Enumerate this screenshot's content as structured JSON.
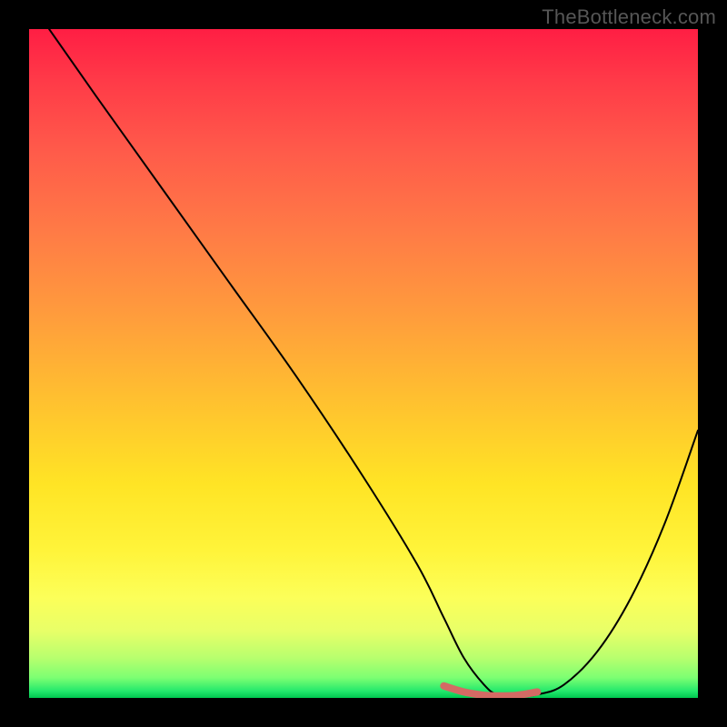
{
  "watermark": "TheBottleneck.com",
  "chart_data": {
    "type": "line",
    "title": "",
    "xlabel": "",
    "ylabel": "",
    "xlim": [
      0,
      100
    ],
    "ylim": [
      0,
      100
    ],
    "grid": false,
    "legend": false,
    "series": [
      {
        "name": "curve",
        "color": "#000000",
        "x": [
          3,
          10,
          20,
          30,
          40,
          50,
          58,
          62,
          65,
          68,
          70,
          73,
          76,
          80,
          85,
          90,
          95,
          100
        ],
        "y": [
          100,
          90,
          76,
          62,
          48,
          33,
          20,
          12,
          6,
          2,
          0.5,
          0.2,
          0.5,
          2,
          7,
          15,
          26,
          40
        ]
      },
      {
        "name": "highlight",
        "color": "#d46a64",
        "x": [
          62,
          65,
          68,
          70,
          73,
          76
        ],
        "y": [
          1.8,
          0.9,
          0.4,
          0.3,
          0.4,
          0.9
        ]
      }
    ],
    "background_gradient": {
      "top": "#ff1e44",
      "mid1": "#ff9a3d",
      "mid2": "#ffe425",
      "bottom": "#00c74f"
    }
  }
}
